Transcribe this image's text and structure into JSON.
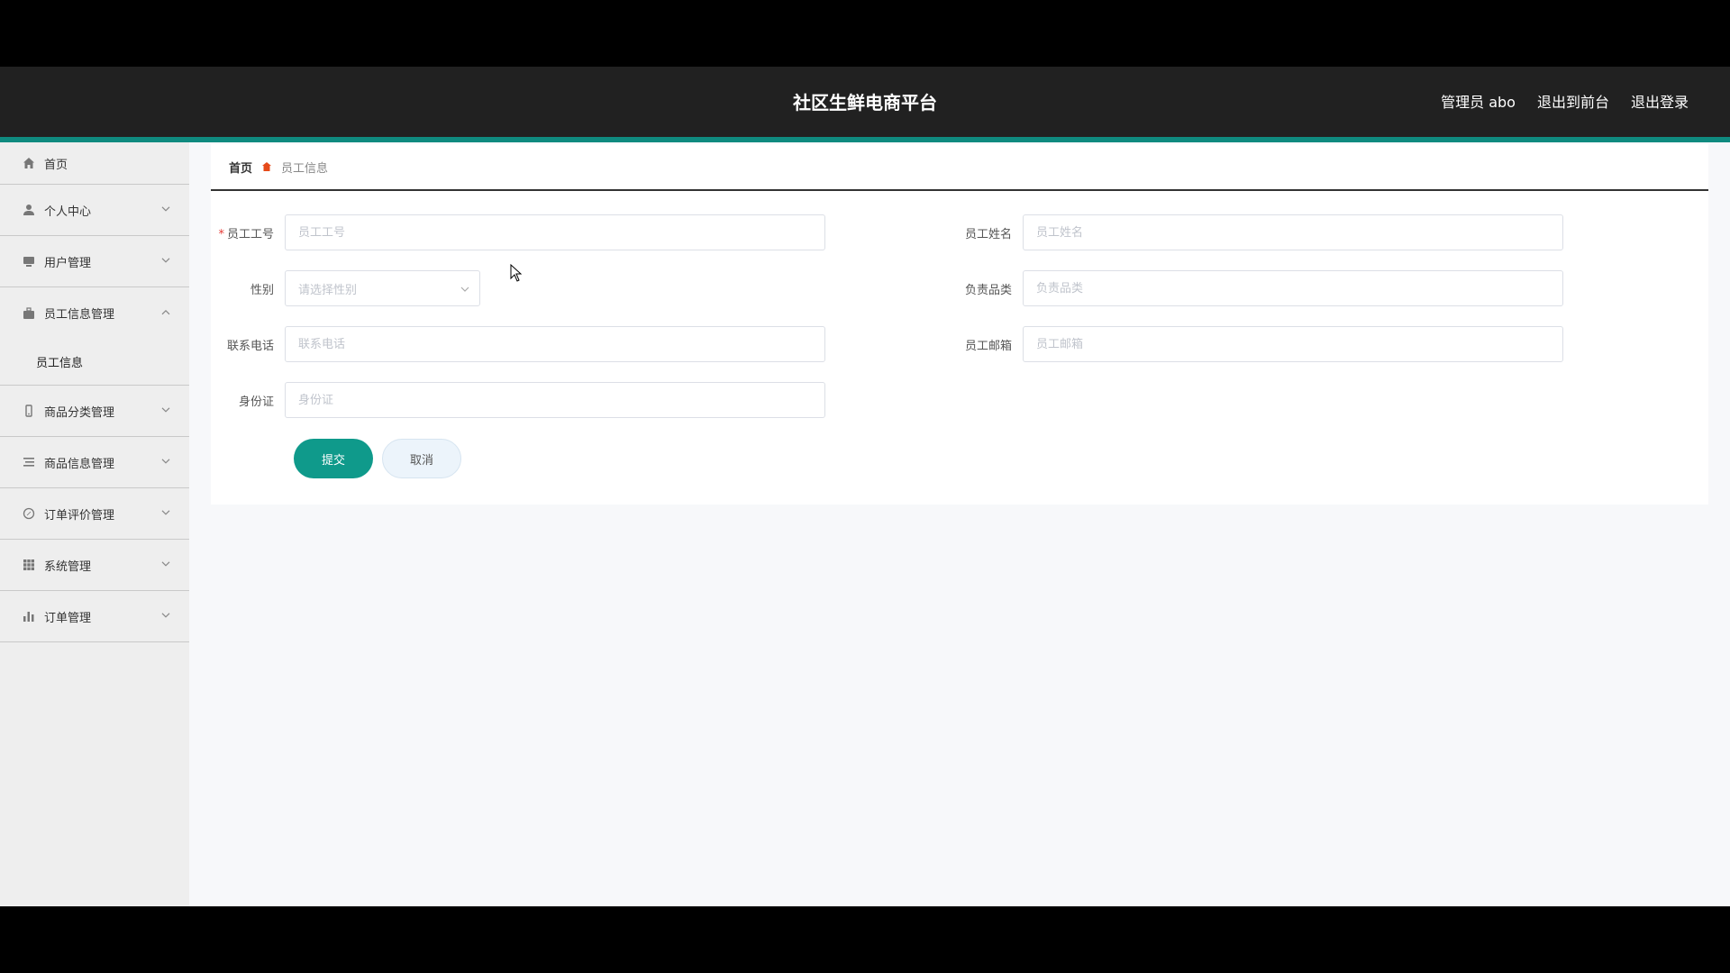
{
  "header": {
    "title": "社区生鲜电商平台",
    "admin": "管理员 abo",
    "to_front": "退出到前台",
    "logout": "退出登录"
  },
  "colors": {
    "accent": "#0f8a7f",
    "primary_button": "#0f9a8b",
    "header_bg": "#212121"
  },
  "sidebar": {
    "items": [
      {
        "label": "首页",
        "icon": "home-icon"
      },
      {
        "label": "个人中心",
        "icon": "user-icon"
      },
      {
        "label": "用户管理",
        "icon": "monitor-icon"
      },
      {
        "label": "员工信息管理",
        "icon": "briefcase-icon",
        "expanded": true,
        "sub": "员工信息"
      },
      {
        "label": "商品分类管理",
        "icon": "phone-icon"
      },
      {
        "label": "商品信息管理",
        "icon": "list-icon"
      },
      {
        "label": "订单评价管理",
        "icon": "compass-icon"
      },
      {
        "label": "系统管理",
        "icon": "grid-icon"
      },
      {
        "label": "订单管理",
        "icon": "bar-chart-icon"
      }
    ]
  },
  "breadcrumb": {
    "home": "首页",
    "current": "员工信息"
  },
  "form": {
    "employee_no": {
      "label": "员工工号",
      "placeholder": "员工工号",
      "required": true
    },
    "employee_name": {
      "label": "员工姓名",
      "placeholder": "员工姓名"
    },
    "gender": {
      "label": "性别",
      "placeholder": "请选择性别"
    },
    "category": {
      "label": "负责品类",
      "placeholder": "负责品类"
    },
    "phone": {
      "label": "联系电话",
      "placeholder": "联系电话"
    },
    "email": {
      "label": "员工邮箱",
      "placeholder": "员工邮箱"
    },
    "id_card": {
      "label": "身份证",
      "placeholder": "身份证"
    },
    "submit": "提交",
    "cancel": "取消"
  }
}
